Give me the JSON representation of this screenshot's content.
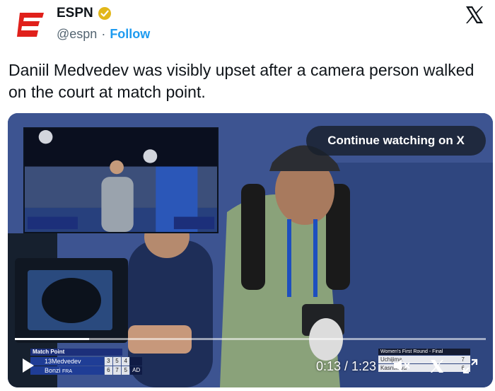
{
  "author": {
    "display_name": "ESPN",
    "handle": "@espn",
    "separator": "·",
    "follow_label": "Follow"
  },
  "tweet": {
    "text": "Daniil Medvedev was visibly upset after a camera person walked on the court at match point."
  },
  "video": {
    "continue_label": "Continue watching on X",
    "current_time": "0:13",
    "duration": "1:23",
    "time_display": "0:13 / 1:23",
    "progress_fraction": 0.157,
    "scorebug": {
      "title": "Match Point",
      "players": [
        {
          "seed": "13",
          "name": "Medvedev",
          "sets": [
            "3",
            "5",
            "4"
          ],
          "point": ""
        },
        {
          "seed": "",
          "name": "Bonzi",
          "country": "FRA",
          "sets": [
            "6",
            "7",
            "5"
          ],
          "point": "AD"
        }
      ]
    },
    "other_match_bug": {
      "title": "Women's First Round - Final",
      "rows": [
        "Uchijima",
        "Kasnikova"
      ],
      "scores": [
        [
          "7",
          ""
        ],
        [
          "6",
          ""
        ]
      ]
    }
  },
  "colors": {
    "espn_red": "#e0201b",
    "follow_blue": "#1d9bf0",
    "verified_gold": "#e2b719",
    "text_dark": "#0f1419",
    "text_muted": "#536471"
  },
  "icons": {
    "avatar": "espn-logo-icon",
    "verified": "verified-badge-icon",
    "brand": "x-logo-icon",
    "play": "play-icon",
    "volume": "volume-muted-icon",
    "video_x": "x-logo-icon",
    "fullscreen": "fullscreen-icon"
  }
}
